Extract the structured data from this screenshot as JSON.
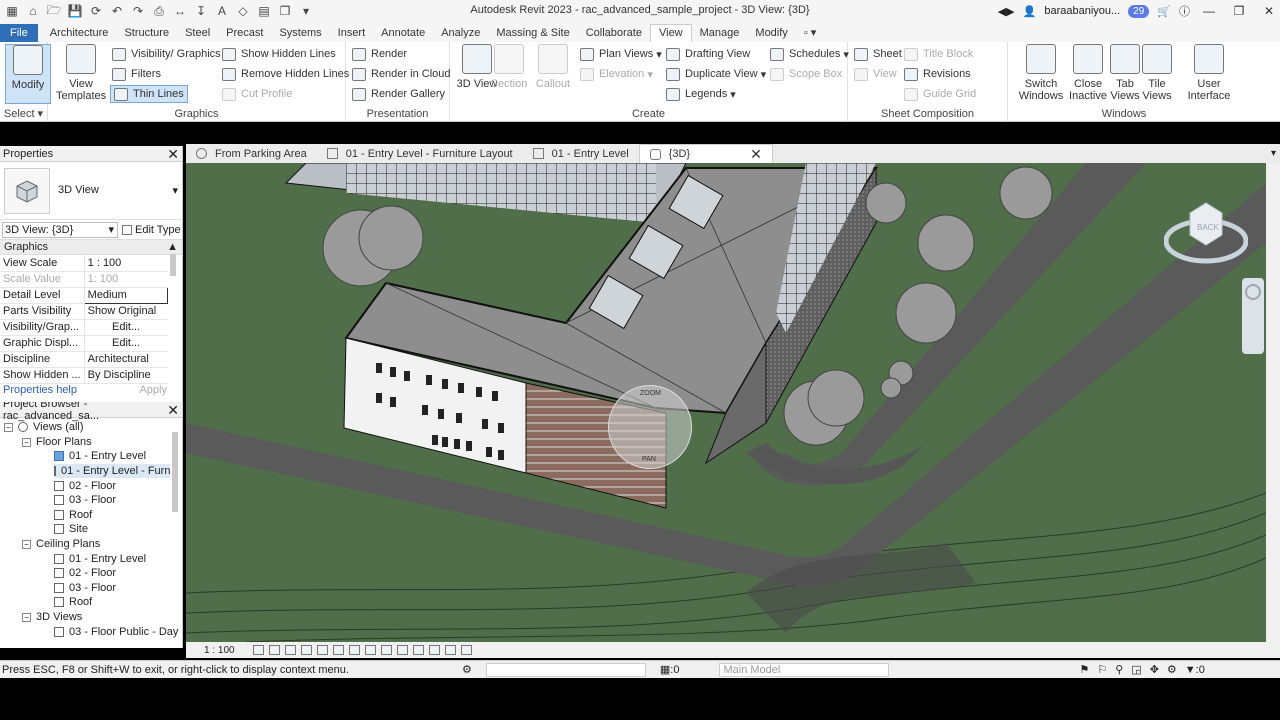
{
  "app": {
    "title": "Autodesk Revit 2023 - rac_advanced_sample_project - 3D View: {3D}",
    "user": "baraabaniyou...",
    "notifications": "29"
  },
  "ribbon_tabs": [
    "File",
    "Architecture",
    "Structure",
    "Steel",
    "Precast",
    "Systems",
    "Insert",
    "Annotate",
    "Analyze",
    "Massing & Site",
    "Collaborate",
    "View",
    "Manage",
    "Modify"
  ],
  "active_tab": "View",
  "ribbon": {
    "select": {
      "modify": "Modify",
      "label": "Select"
    },
    "graphics": {
      "label": "Graphics",
      "view_templates": "View Templates",
      "visibility_graphics": "Visibility/ Graphics",
      "filters": "Filters",
      "thin_lines": "Thin Lines",
      "show_hidden_lines": "Show Hidden Lines",
      "remove_hidden_lines": "Remove Hidden Lines",
      "cut_profile": "Cut Profile"
    },
    "presentation": {
      "label": "Presentation",
      "render": "Render",
      "render_cloud": "Render in Cloud",
      "render_gallery": "Render Gallery"
    },
    "create": {
      "label": "Create",
      "view_3d": "3D View",
      "section": "Section",
      "callout": "Callout",
      "plan_views": "Plan Views",
      "elevation": "Elevation",
      "drafting_view": "Drafting View",
      "duplicate_view": "Duplicate View",
      "legends": "Legends",
      "schedules": "Schedules",
      "scope_box": "Scope Box"
    },
    "sheet": {
      "label": "Sheet Composition",
      "sheet": "Sheet",
      "title_block": "Title Block",
      "view": "View",
      "revisions": "Revisions",
      "guide_grid": "Guide Grid"
    },
    "windows": {
      "label": "Windows",
      "switch_windows": "Switch Windows",
      "close_inactive": "Close Inactive",
      "tab_views": "Tab Views",
      "tile_views": "Tile Views",
      "user_interface": "User Interface"
    }
  },
  "properties": {
    "title": "Properties",
    "type": "3D View",
    "filter": "3D View: {3D}",
    "edit_type": "Edit Type",
    "group": "Graphics",
    "rows": [
      {
        "k": "View Scale",
        "v": "1 : 100"
      },
      {
        "k": "Scale Value",
        "v": "1: 100"
      },
      {
        "k": "Detail Level",
        "v": "Medium"
      },
      {
        "k": "Parts Visibility",
        "v": "Show Original"
      },
      {
        "k": "Visibility/Grap...",
        "v": "Edit..."
      },
      {
        "k": "Graphic Displ...",
        "v": "Edit..."
      },
      {
        "k": "Discipline",
        "v": "Architectural"
      },
      {
        "k": "Show Hidden ...",
        "v": "By Discipline"
      }
    ],
    "help": "Properties help",
    "apply": "Apply"
  },
  "browser": {
    "title": "Project Browser - rac_advanced_sa...",
    "nodes": [
      {
        "t": "Views (all)"
      },
      {
        "t": "Floor Plans"
      },
      {
        "t": "01 - Entry Level"
      },
      {
        "t": "01 - Entry Level - Furn"
      },
      {
        "t": "02 - Floor"
      },
      {
        "t": "03 - Floor"
      },
      {
        "t": "Roof"
      },
      {
        "t": "Site"
      },
      {
        "t": "Ceiling Plans"
      },
      {
        "t": "01 - Entry Level"
      },
      {
        "t": "02 - Floor"
      },
      {
        "t": "03 - Floor"
      },
      {
        "t": "Roof"
      },
      {
        "t": "3D Views"
      },
      {
        "t": "03 - Floor Public - Day"
      }
    ]
  },
  "doc_tabs": [
    "From Parking Area",
    "01 - Entry Level - Furniture Layout",
    "01 - Entry Level",
    "{3D}"
  ],
  "viewcube": {
    "face": "BACK",
    "nav_wheel": [
      "ZOOM",
      "PAN"
    ]
  },
  "view_bar": {
    "scale": "1 : 100"
  },
  "status": {
    "message": "Press ESC, F8 or Shift+W to exit, or right-click to display context menu.",
    "count": ":0",
    "model": "Main Model",
    "filter_count": ":0"
  },
  "colors": {
    "file_tab": "#2f6fb7",
    "grass": "#4c6b47",
    "road": "#585858",
    "roof": "#8e8e8e",
    "selection": "#cfe3f7"
  }
}
